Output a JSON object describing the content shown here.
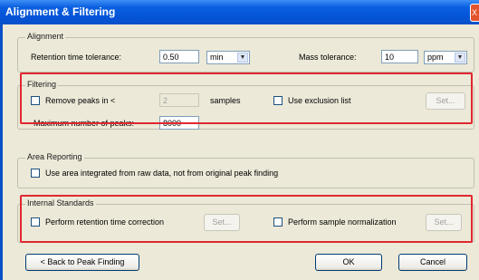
{
  "window": {
    "title": "Alignment & Filtering",
    "close_symbol": "X"
  },
  "alignment": {
    "title": "Alignment",
    "rt_label": "Retention time tolerance:",
    "rt_value": "0.50",
    "rt_unit": "min",
    "mass_label": "Mass tolerance:",
    "mass_value": "10",
    "mass_unit": "ppm"
  },
  "filtering": {
    "title": "Filtering",
    "remove_label": "Remove peaks in <",
    "remove_value": "2",
    "samples_label": "samples",
    "exclusion_label": "Use exclusion list",
    "set_label": "Set...",
    "max_peaks_label": "Maximum number of peaks:",
    "max_peaks_value": "8000"
  },
  "area": {
    "title": "Area Reporting",
    "option_label": "Use area integrated from raw data, not from original peak finding"
  },
  "internal": {
    "title": "Internal Standards",
    "rt_correction_label": "Perform retention time correction",
    "set_label_1": "Set...",
    "normalization_label": "Perform sample normalization",
    "set_label_2": "Set..."
  },
  "buttons": {
    "back": "< Back to Peak Finding",
    "ok": "OK",
    "cancel": "Cancel"
  },
  "colors": {
    "highlight": "#e0282f",
    "titlebar": "#0454d8",
    "dialog_bg": "#ece9d8"
  }
}
